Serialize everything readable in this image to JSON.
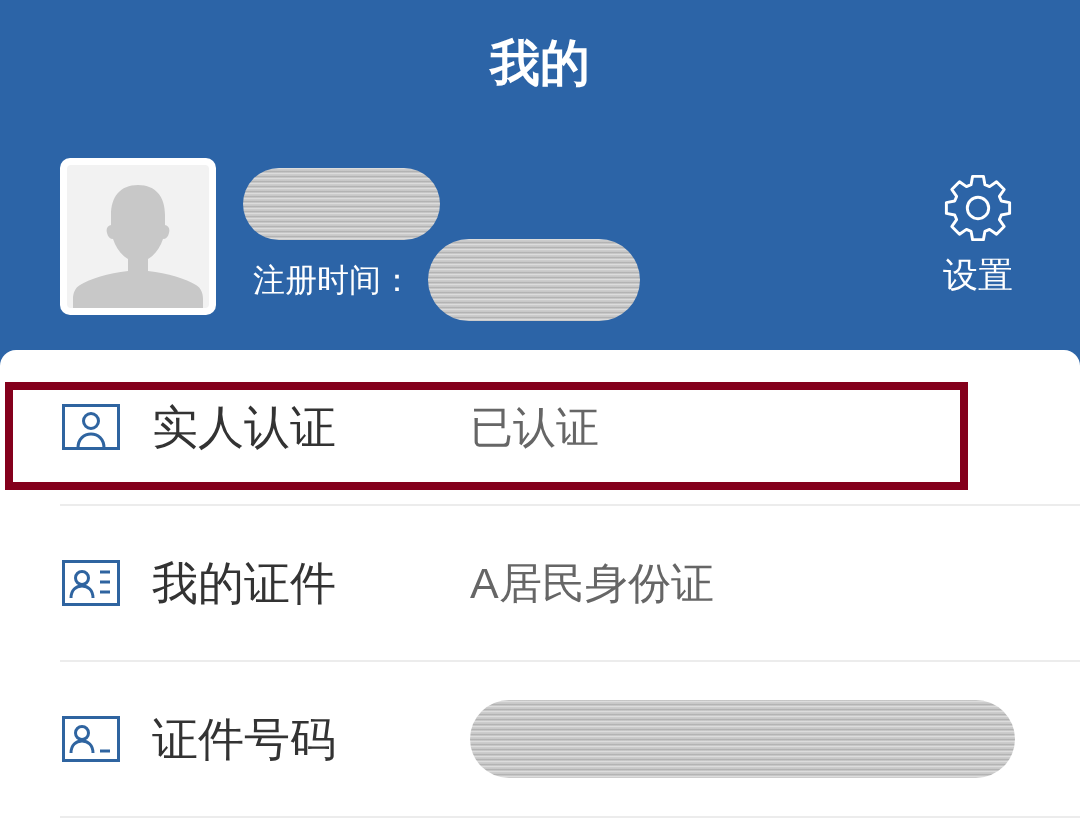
{
  "header": {
    "title": "我的"
  },
  "profile": {
    "name_redacted": true,
    "registration_label": "注册时间：",
    "registration_redacted": true
  },
  "settings": {
    "label": "设置"
  },
  "rows": [
    {
      "label": "实人认证",
      "value": "已认证",
      "redacted": false,
      "highlighted": true
    },
    {
      "label": "我的证件",
      "value": "A居民身份证",
      "redacted": false,
      "highlighted": false
    },
    {
      "label": "证件号码",
      "redacted": true,
      "highlighted": false
    }
  ]
}
